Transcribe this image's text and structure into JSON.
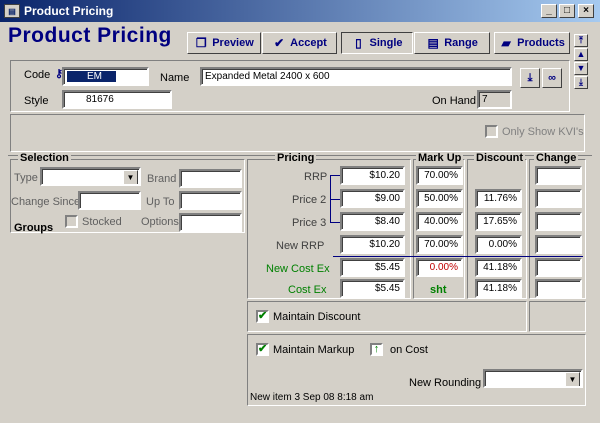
{
  "window": {
    "title": "Product Pricing"
  },
  "header": {
    "title": "Product Pricing"
  },
  "toolbar": {
    "preview": "Preview",
    "accept": "Accept",
    "single": "Single",
    "range": "Range",
    "products": "Products"
  },
  "product": {
    "code_label": "Code",
    "code_value": "EM",
    "name_label": "Name",
    "name_value": "Expanded Metal 2400 x 600",
    "style_label": "Style",
    "style_value": "81676",
    "onhand_label": "On Hand",
    "onhand_value": "7",
    "kvi_label": "Only Show KVI's"
  },
  "selection": {
    "title": "Selection",
    "type_label": "Type",
    "type_value": "",
    "brand_label": "Brand",
    "change_since_label": "Change Since",
    "up_to_label": "Up To",
    "stocked_label": "Stocked",
    "options_label": "Options",
    "groups_label": "Groups"
  },
  "pricing": {
    "title": "Pricing",
    "markup_title": "Mark Up",
    "discount_title": "Discount",
    "change_title": "Change",
    "rows": [
      {
        "label": "RRP",
        "value": "$10.20",
        "markup": "70.00%",
        "discount": "",
        "change": ""
      },
      {
        "label": "Price 2",
        "value": "$9.00",
        "markup": "50.00%",
        "discount": "11.76%",
        "change": ""
      },
      {
        "label": "Price 3",
        "value": "$8.40",
        "markup": "40.00%",
        "discount": "17.65%",
        "change": ""
      },
      {
        "label": "New RRP",
        "value": "$10.20",
        "markup": "70.00%",
        "discount": "0.00%",
        "change": ""
      },
      {
        "label": "New Cost Ex",
        "value": "$5.45",
        "markup": "0.00%",
        "discount": "41.18%",
        "change": ""
      },
      {
        "label": "Cost Ex",
        "value": "$5.45",
        "markup": "sht",
        "discount": "41.18%",
        "change": ""
      }
    ],
    "maintain_discount": "Maintain Discount",
    "maintain_markup": "Maintain Markup",
    "on_cost": "on Cost",
    "new_rounding_label": "New Rounding",
    "new_rounding_value": "",
    "status": "New item 3 Sep 08 8:18 am"
  },
  "colors": {
    "title_bar": "#0a246a",
    "accent": "#000080",
    "green": "#008000",
    "red": "#c00000"
  }
}
